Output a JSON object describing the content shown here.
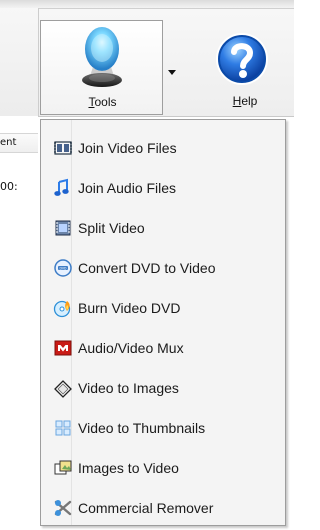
{
  "toolbar": {
    "tools_label": "Tools",
    "help_label": "Help",
    "left_partial_header": "ent",
    "left_partial_time": "00:"
  },
  "menu": {
    "items": [
      {
        "label": "Join Video Files",
        "icon": "join-video-icon"
      },
      {
        "label": "Join Audio Files",
        "icon": "join-audio-icon"
      },
      {
        "label": "Split Video",
        "icon": "split-video-icon"
      },
      {
        "label": "Convert DVD to Video",
        "icon": "dvd-icon"
      },
      {
        "label": "Burn Video DVD",
        "icon": "burn-dvd-icon"
      },
      {
        "label": "Audio/Video Mux",
        "icon": "mux-icon"
      },
      {
        "label": "Video to Images",
        "icon": "video-images-icon"
      },
      {
        "label": "Video to Thumbnails",
        "icon": "thumbnails-icon"
      },
      {
        "label": "Images to Video",
        "icon": "images-video-icon"
      },
      {
        "label": "Commercial Remover",
        "icon": "commercial-remover-icon"
      }
    ]
  },
  "colors": {
    "menu_background": "#f4f4f4",
    "menu_border": "#9d9d9d",
    "toolbar_border": "#c9c9c9",
    "help_blue": "#1f64c8",
    "tools_blue": "#4bb8ff"
  }
}
